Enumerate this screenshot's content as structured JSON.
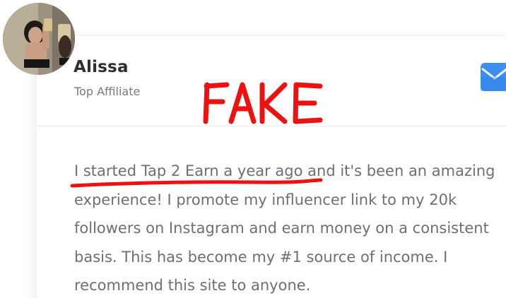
{
  "profile": {
    "name": "Alissa",
    "role": "Top Affiliate"
  },
  "annotation": {
    "stamp_text": "FAKE",
    "stamp_color": "#ee1111"
  },
  "testimonial": {
    "text": "I started Tap 2 Earn a year ago and it's been an amazing experience! I promote my influencer link to my 20k followers on Instagram and earn money on a consistent basis. This has become my #1 source of income. I recommend this site to anyone."
  },
  "icons": {
    "contact": "mail-icon",
    "accent": "#3a8ff0"
  }
}
